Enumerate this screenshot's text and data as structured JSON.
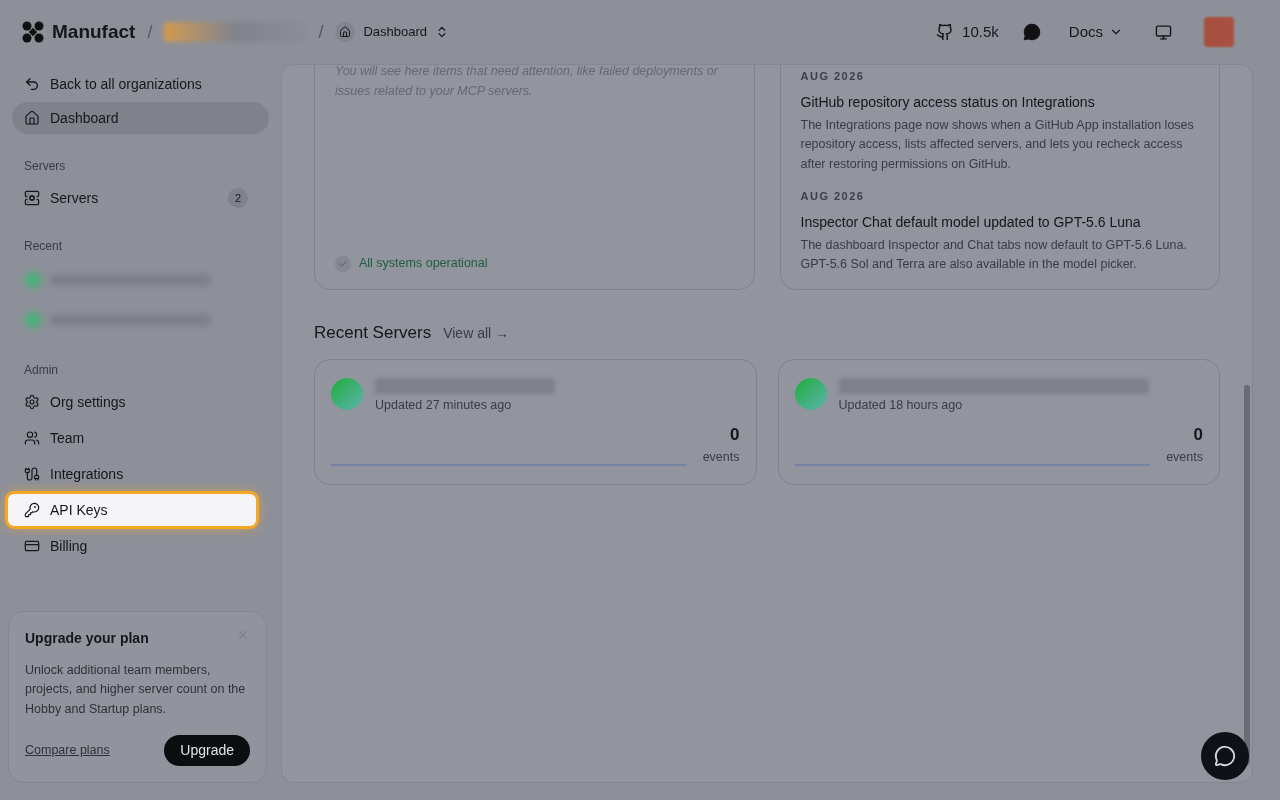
{
  "header": {
    "brand": "Manufact",
    "separator_1": "/",
    "separator_2": "/",
    "page_switcher": "Dashboard",
    "github_stars": "10.5k",
    "docs": "Docs"
  },
  "sidebar": {
    "back_link": "Back to all organizations",
    "top_items": [
      {
        "label": "Dashboard",
        "kind": "home",
        "selected": true,
        "highlighted": false
      }
    ],
    "sections": [
      {
        "title": "Servers",
        "kind": "nav",
        "items": [
          {
            "label": "Servers",
            "kind": "server",
            "badge": "2",
            "selected": false,
            "highlighted": false
          }
        ]
      },
      {
        "title": "Recent",
        "kind": "recent"
      },
      {
        "title": "Admin",
        "kind": "nav",
        "items": [
          {
            "label": "Org settings",
            "kind": "gear",
            "selected": false,
            "highlighted": false
          },
          {
            "label": "Team",
            "kind": "users",
            "selected": false,
            "highlighted": false
          },
          {
            "label": "Integrations",
            "kind": "plug",
            "selected": false,
            "highlighted": false
          },
          {
            "label": "API Keys",
            "kind": "key",
            "selected": false,
            "highlighted": true
          },
          {
            "label": "Billing",
            "kind": "card",
            "selected": false,
            "highlighted": false
          }
        ]
      }
    ],
    "upgrade": {
      "title": "Upgrade your plan",
      "text": "Unlock additional team members, projects, and higher server count on the Hobby and Startup plans.",
      "link": "Compare plans",
      "button": "Upgrade"
    }
  },
  "attention": {
    "text": "You will see here items that need attention, like failed deployments or issues related to your MCP servers.",
    "status": "All systems operational"
  },
  "changelog": [
    {
      "date": "AUG 2026",
      "title": "GitHub repository access status on Integrations",
      "text": "The Integrations page now shows when a GitHub App installation loses repository access, lists affected servers, and lets you recheck access after restoring permissions on GitHub."
    },
    {
      "date": "AUG 2026",
      "title": "Inspector Chat default model updated to GPT-5.6 Luna",
      "text": "The dashboard Inspector and Chat tabs now default to GPT-5.6 Luna. GPT-5.6 Sol and Terra are also available in the model picker."
    }
  ],
  "recent_servers": {
    "title": "Recent Servers",
    "view_all": "View all →",
    "servers": [
      {
        "updated": "Updated 27 minutes ago",
        "count": "0",
        "unit": "events"
      },
      {
        "updated": "Updated 18 hours ago",
        "count": "0",
        "unit": "events"
      }
    ]
  }
}
